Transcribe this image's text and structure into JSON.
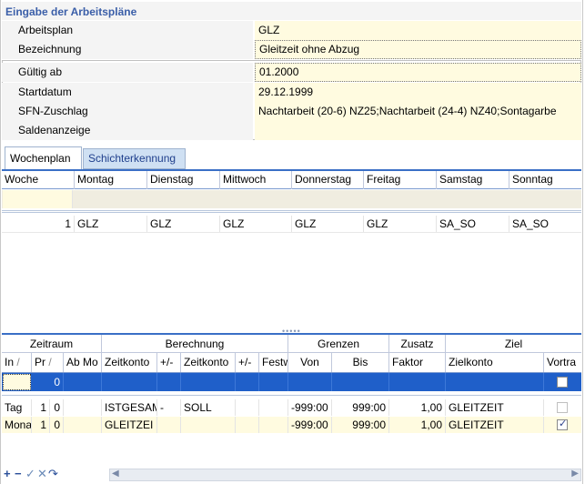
{
  "section": {
    "title": "Eingabe der Arbeitspläne"
  },
  "form": {
    "arbeitsplan_label": "Arbeitsplan",
    "arbeitsplan_value": "GLZ",
    "bezeichnung_label": "Bezeichnung",
    "bezeichnung_value": "Gleitzeit ohne Abzug",
    "gueltig_label": "Gültig ab",
    "gueltig_value": "01.2000",
    "startdatum_label": "Startdatum",
    "startdatum_value": "29.12.1999",
    "sfn_label": "SFN-Zuschlag",
    "sfn_value": "Nachtarbeit (20-6) NZ25;Nachtarbeit (24-4) NZ40;Sontagarbe",
    "salden_label": "Saldenanzeige",
    "salden_value": ""
  },
  "tabs": [
    {
      "label": "Wochenplan",
      "active": true
    },
    {
      "label": "Schichterkennung",
      "active": false
    }
  ],
  "week_grid": {
    "columns": [
      "Woche",
      "Montag",
      "Dienstag",
      "Mittwoch",
      "Donnerstag",
      "Freitag",
      "Samstag",
      "Sonntag"
    ],
    "rows": [
      [
        "1",
        "GLZ",
        "GLZ",
        "GLZ",
        "GLZ",
        "GLZ",
        "SA_SO",
        "SA_SO"
      ]
    ]
  },
  "rules_grid": {
    "groups": [
      "Zeitraum",
      "Berechnung",
      "Grenzen",
      "Zusatz",
      "Ziel"
    ],
    "columns": [
      "In",
      "Pr",
      "Ab Mo",
      "Zeitkonto",
      "+/-",
      "Zeitkonto",
      "+/-",
      "Festw",
      "Von",
      "Bis",
      "Faktor",
      "Zielkonto",
      "Vortra"
    ],
    "sort_marks": [
      "/",
      "/"
    ],
    "selected_row": {
      "ab": "0",
      "checked": false
    },
    "rows": [
      {
        "in": "Tag",
        "pr": "1",
        "ab": "0",
        "zk1": "ISTGESAM",
        "pm1": "-",
        "zk2": "SOLL",
        "pm2": "",
        "fest": "",
        "von": "-999:00",
        "bis": "999:00",
        "faktor": "1,00",
        "ziel": "GLEITZEIT",
        "checked": false
      },
      {
        "in": "Mona",
        "pr": "1",
        "ab": "0",
        "zk1": "GLEITZEI",
        "pm1": "",
        "zk2": "",
        "pm2": "",
        "fest": "",
        "von": "-999:00",
        "bis": "999:00",
        "faktor": "1,00",
        "ziel": "GLEITZEIT",
        "checked": true
      }
    ]
  },
  "toolbar": {
    "icons": [
      "add-icon",
      "remove-icon",
      "confirm-icon",
      "cancel-icon",
      "refresh-icon"
    ]
  },
  "colors": {
    "accent": "#1f5fc9",
    "title": "#3a5ea8",
    "input_bg": "#fffbe0"
  }
}
